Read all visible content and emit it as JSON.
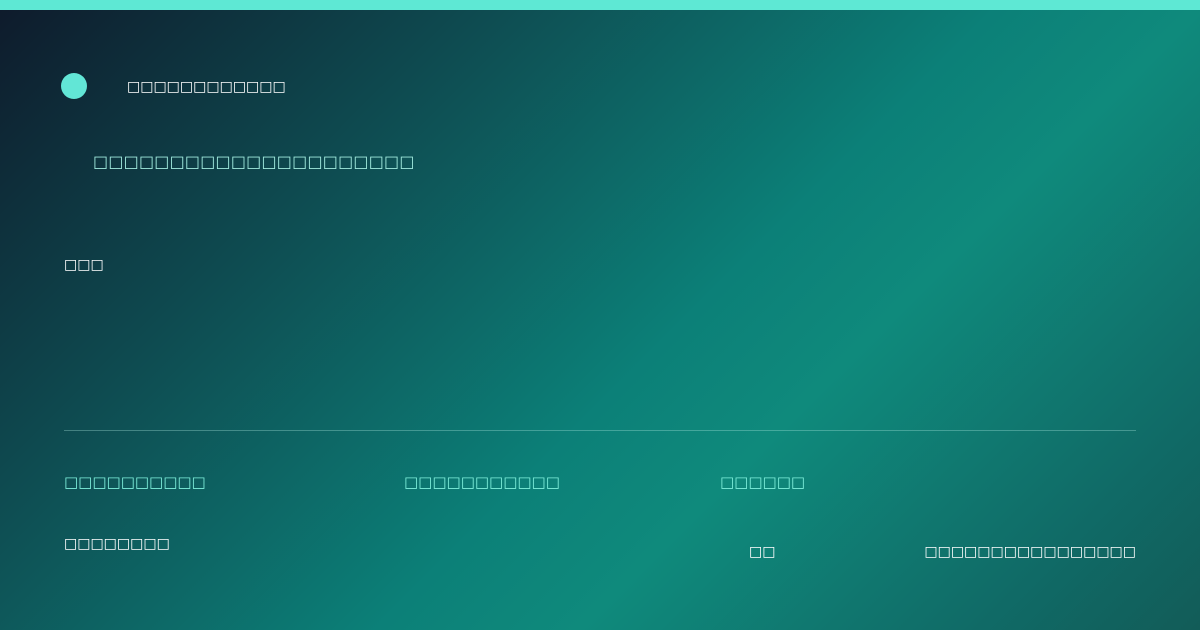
{
  "colors": {
    "accent": "#5ee8d4",
    "subtitle_text": "#9fe8dc",
    "meta_text": "#7ff0dc",
    "primary_text": "#ffffff"
  },
  "brand": {
    "icon": "brand-dot-icon",
    "name": "□□□□□□□□□□□□"
  },
  "subtitle": "□□□□□□□□□□□□□□□□□□□□□",
  "headline": "□□□",
  "meta": [
    "□□□□□□□□□□",
    "□□□□□□□□□□□",
    "□□□□□□"
  ],
  "footer": {
    "left": "□□□□□□□□",
    "middle": "□□",
    "right": "□□□□□□□□□□□□□□□□"
  }
}
